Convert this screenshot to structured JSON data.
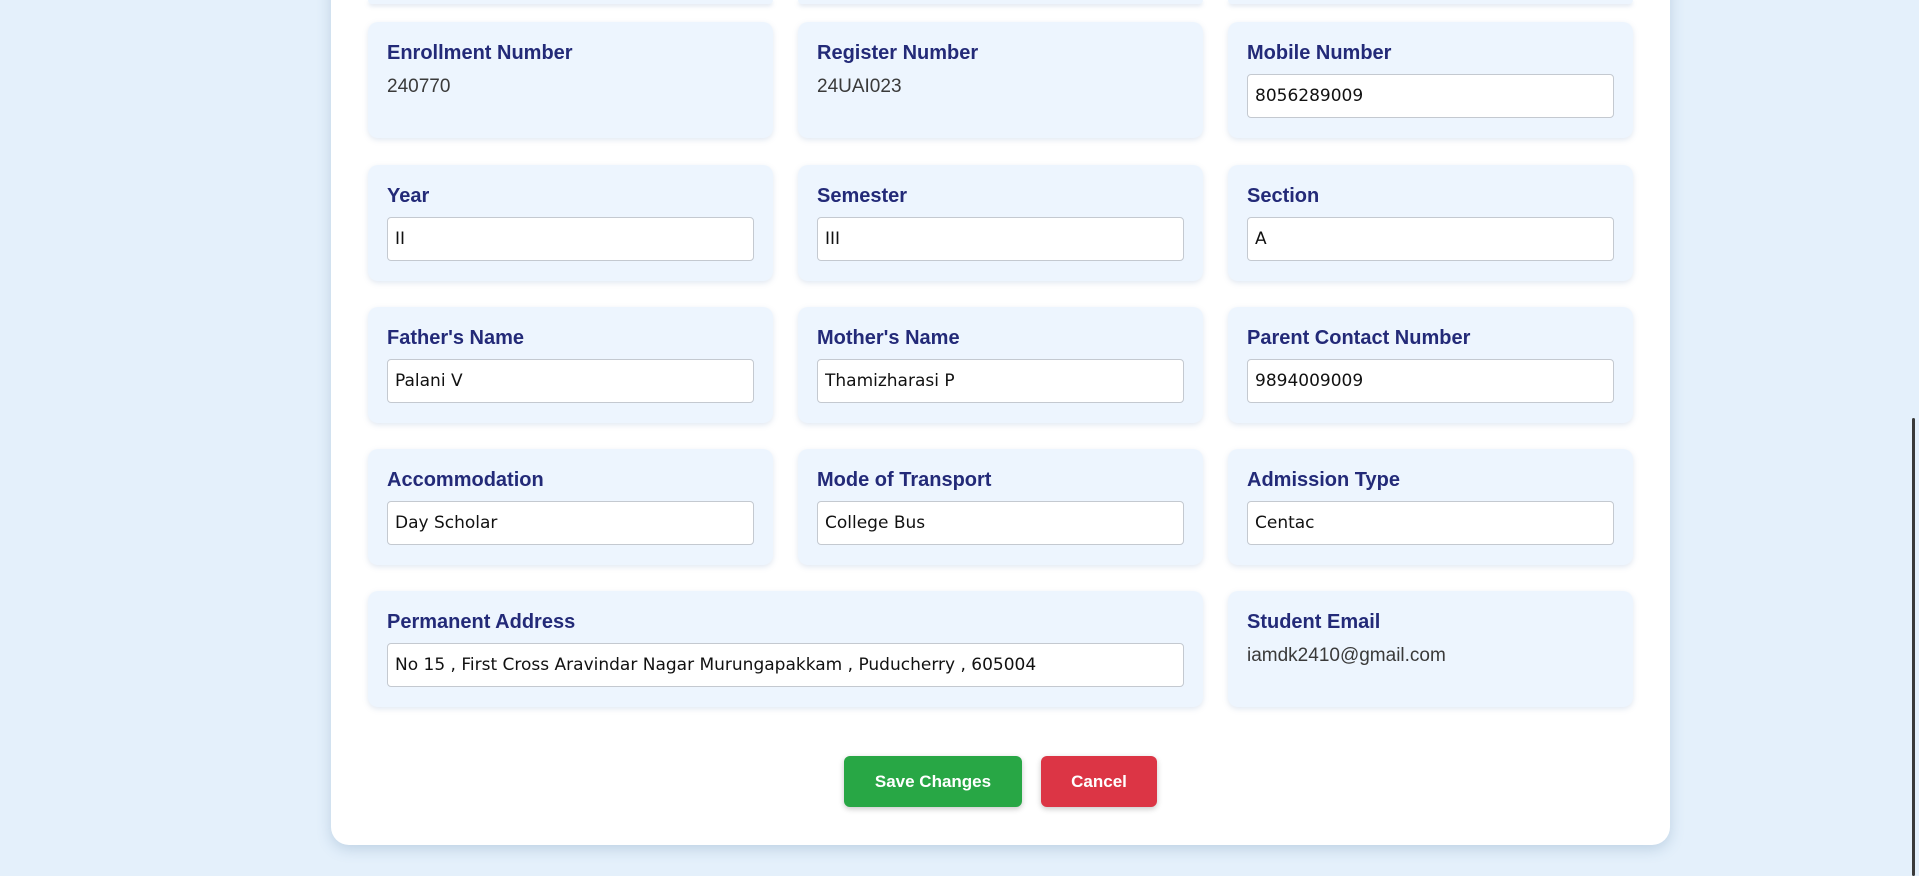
{
  "fields": {
    "enrollment_number": {
      "label": "Enrollment Number",
      "value": "240770"
    },
    "register_number": {
      "label": "Register Number",
      "value": "24UAI023"
    },
    "mobile_number": {
      "label": "Mobile Number",
      "value": "8056289009"
    },
    "year": {
      "label": "Year",
      "value": "II"
    },
    "semester": {
      "label": "Semester",
      "value": "III"
    },
    "section": {
      "label": "Section",
      "value": "A"
    },
    "fathers_name": {
      "label": "Father's Name",
      "value": "Palani V"
    },
    "mothers_name": {
      "label": "Mother's Name",
      "value": "Thamizharasi P"
    },
    "parent_contact": {
      "label": "Parent Contact Number",
      "value": "9894009009"
    },
    "accommodation": {
      "label": "Accommodation",
      "value": "Day Scholar"
    },
    "mode_of_transport": {
      "label": "Mode of Transport",
      "value": "College Bus"
    },
    "admission_type": {
      "label": "Admission Type",
      "value": "Centac"
    },
    "permanent_address": {
      "label": "Permanent Address",
      "value": "No 15 , First Cross Aravindar Nagar Murungapakkam , Puducherry , 605004"
    },
    "student_email": {
      "label": "Student Email",
      "value": "iamdk2410@gmail.com"
    }
  },
  "actions": {
    "save_label": "Save Changes",
    "cancel_label": "Cancel"
  },
  "colors": {
    "page_background": "#e4f0fb",
    "field_background": "#edf5fe",
    "label_color": "#232a78",
    "save_button": "#28a745",
    "cancel_button": "#dc3545"
  }
}
